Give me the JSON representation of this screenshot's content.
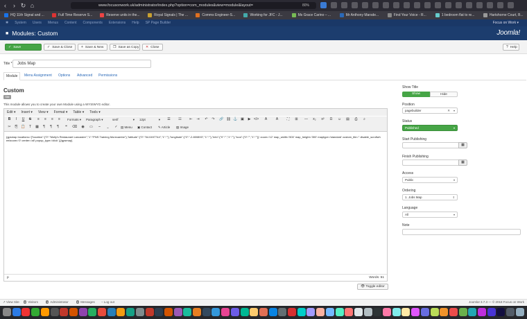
{
  "browser": {
    "url": "www.focusonwork.uk/administrator/index.php?option=com_modules&view=module&layout=",
    "zoom": "80%",
    "bookmarks": [
      {
        "label": "HQ 11th Signal and ...",
        "color": "#1a73e8"
      },
      {
        "label": "Full Time Reserve S...",
        "color": "#d33"
      },
      {
        "label": "Reserve units in the...",
        "color": "#e44"
      },
      {
        "label": "Royal Signals | The ...",
        "color": "#c8a030"
      },
      {
        "label": "Comms Engineer-S...",
        "color": "#e07020"
      },
      {
        "label": "Working for JFC - J...",
        "color": "#4aa"
      },
      {
        "label": "Ms Grace Carino – ...",
        "color": "#7b5"
      },
      {
        "label": "Mr Anthony Marsde...",
        "color": "#2a69b8"
      },
      {
        "label": "Find Your Voice - R...",
        "color": "#888"
      },
      {
        "label": "1 bedroom flat to re...",
        "color": "#6cc"
      },
      {
        "label": "Hartshorne Court, B...",
        "color": "#999"
      }
    ]
  },
  "joomla_menu": {
    "items": [
      "System",
      "Users",
      "Menus",
      "Content",
      "Components",
      "Extensions",
      "Help",
      "SP Page Builder"
    ],
    "user": "Focus on Work"
  },
  "header": {
    "title": "Modules: Custom",
    "logo": "Joomla!"
  },
  "toolbar": {
    "save": "Save",
    "save_close": "Save & Close",
    "save_new": "Save & New",
    "save_copy": "Save as Copy",
    "close": "Close",
    "help": "Help"
  },
  "form": {
    "title_label": "Title *",
    "title_value": "Jobs Map"
  },
  "tabs": [
    "Module",
    "Menu Assignment",
    "Options",
    "Advanced",
    "Permissions"
  ],
  "module": {
    "heading": "Custom",
    "badge": "Site",
    "description": "This module allows you to create your own Module using a WYSIWYG editor."
  },
  "editor": {
    "menus": [
      "Edit",
      "Insert",
      "View",
      "Format",
      "Table",
      "Tools"
    ],
    "format_select": "Formats",
    "paragraph_select": "Paragraph",
    "font_select": "serif",
    "size_select": "12pt",
    "btn_menu": "Menu",
    "btn_contact": "Contact",
    "btn_article": "Article",
    "btn_image": "Image",
    "content": "{gpsmap locations='{\"location\":{\"0\":\"Molly's Restaurant Lancaster\",\"1\":\"PNS Training Morecambe\"},\"latitude\":{\"0\":\"54.0497744\",\"1\":\"\"},\"longitude\":{\"0\":\"-2.800893\",\"1\":\"\"},\"info\":{\"0\":\"\",\"1\":\"\"},\"icon\":{\"0\":\"\",\"1\":\"\"}}' zoom='12' map_width='500' map_height='300' maptype='standard' custom_tile='' disable_scrollwheelzoom='0' center='all' popup_type='click' }{/gpsmap}",
    "path": "p",
    "words": "Words: 51",
    "toggle": "Toggle editor"
  },
  "sidebar": {
    "show_title_label": "Show Title",
    "show": "Show",
    "hide": "Hide",
    "position_label": "Position",
    "position_value": "pagebuilder",
    "status_label": "Status",
    "status_value": "Published",
    "start_publishing_label": "Start Publishing",
    "finish_publishing_label": "Finish Publishing",
    "access_label": "Access",
    "access_value": "Public",
    "ordering_label": "Ordering",
    "ordering_value": "1. Jobs Map",
    "language_label": "Language",
    "language_value": "All",
    "note_label": "Note"
  },
  "statusbar": {
    "view_site": "View Site",
    "visitors_count": "0",
    "visitors": "Visitors",
    "admin_count": "1",
    "admin": "Administrator",
    "messages_count": "0",
    "messages": "Messages",
    "logout": "Log out",
    "copyright": "Joomla! 3.7.3 — © 2018 Focus on Work"
  },
  "colors": {
    "joomla_bar": "#1a3867",
    "header": "#1c3d6e",
    "save_green": "#46a546",
    "link_blue": "#2a69b8"
  }
}
